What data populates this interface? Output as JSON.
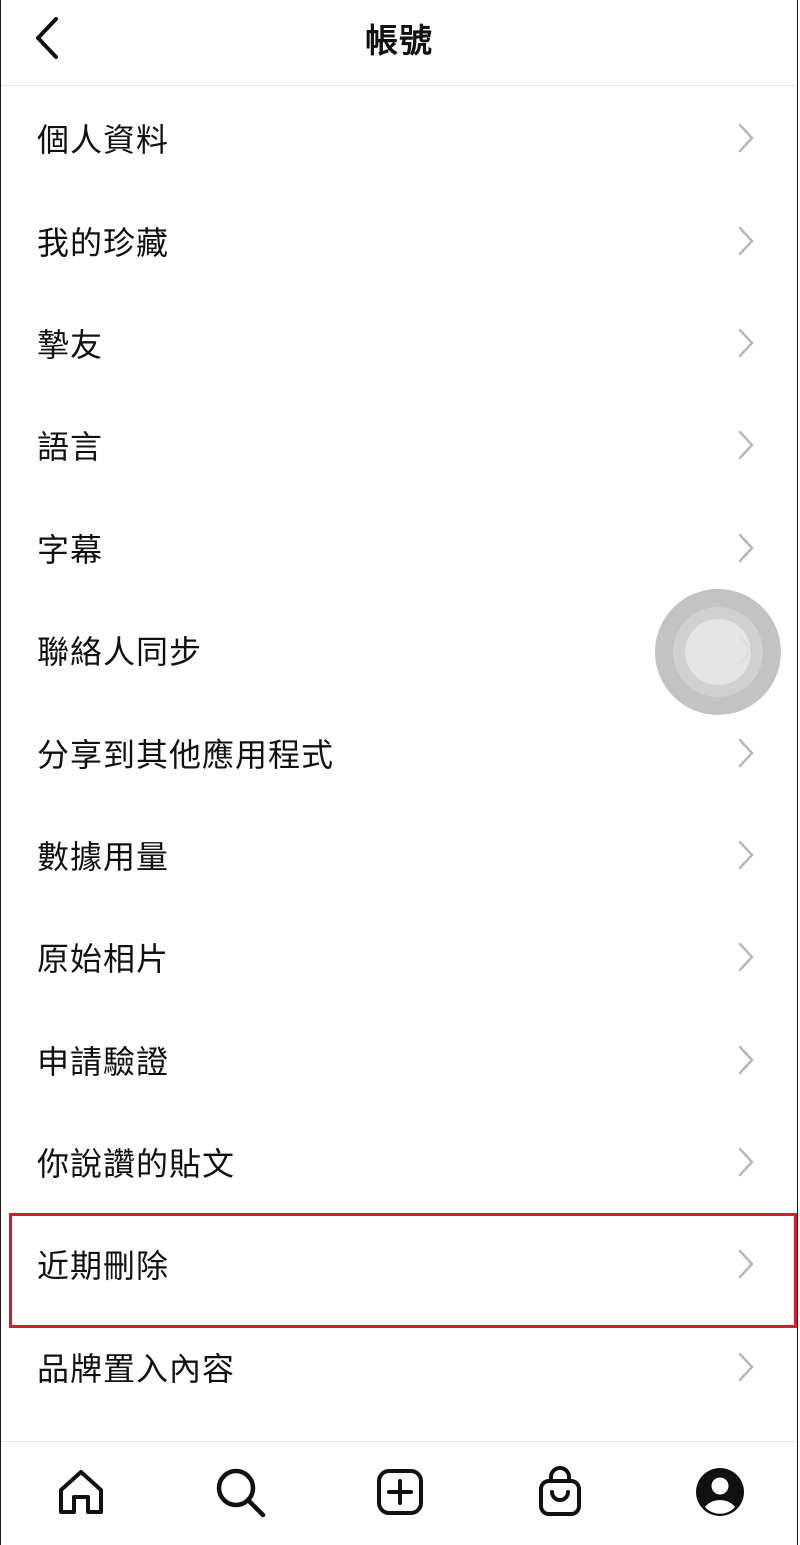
{
  "header": {
    "title": "帳號",
    "back_icon": "chevron-left-icon"
  },
  "menu": {
    "items": [
      {
        "label": "個人資料"
      },
      {
        "label": "我的珍藏"
      },
      {
        "label": "摯友"
      },
      {
        "label": "語言"
      },
      {
        "label": "字幕"
      },
      {
        "label": "聯絡人同步"
      },
      {
        "label": "分享到其他應用程式"
      },
      {
        "label": "數據用量"
      },
      {
        "label": "原始相片"
      },
      {
        "label": "申請驗證"
      },
      {
        "label": "你說讚的貼文"
      },
      {
        "label": "近期刪除"
      },
      {
        "label": "品牌置入內容"
      }
    ],
    "highlighted_item": "近期刪除",
    "chevron_icon": "chevron-right-icon"
  },
  "tabbar": {
    "tabs": [
      {
        "icon": "home-icon"
      },
      {
        "icon": "search-icon"
      },
      {
        "icon": "add-post-icon"
      },
      {
        "icon": "shopping-bag-icon"
      },
      {
        "icon": "profile-icon"
      }
    ]
  },
  "colors": {
    "highlight": "#d0212a",
    "text": "#111111",
    "chevron": "#b8b8b8",
    "divider": "#e6e6e6"
  }
}
